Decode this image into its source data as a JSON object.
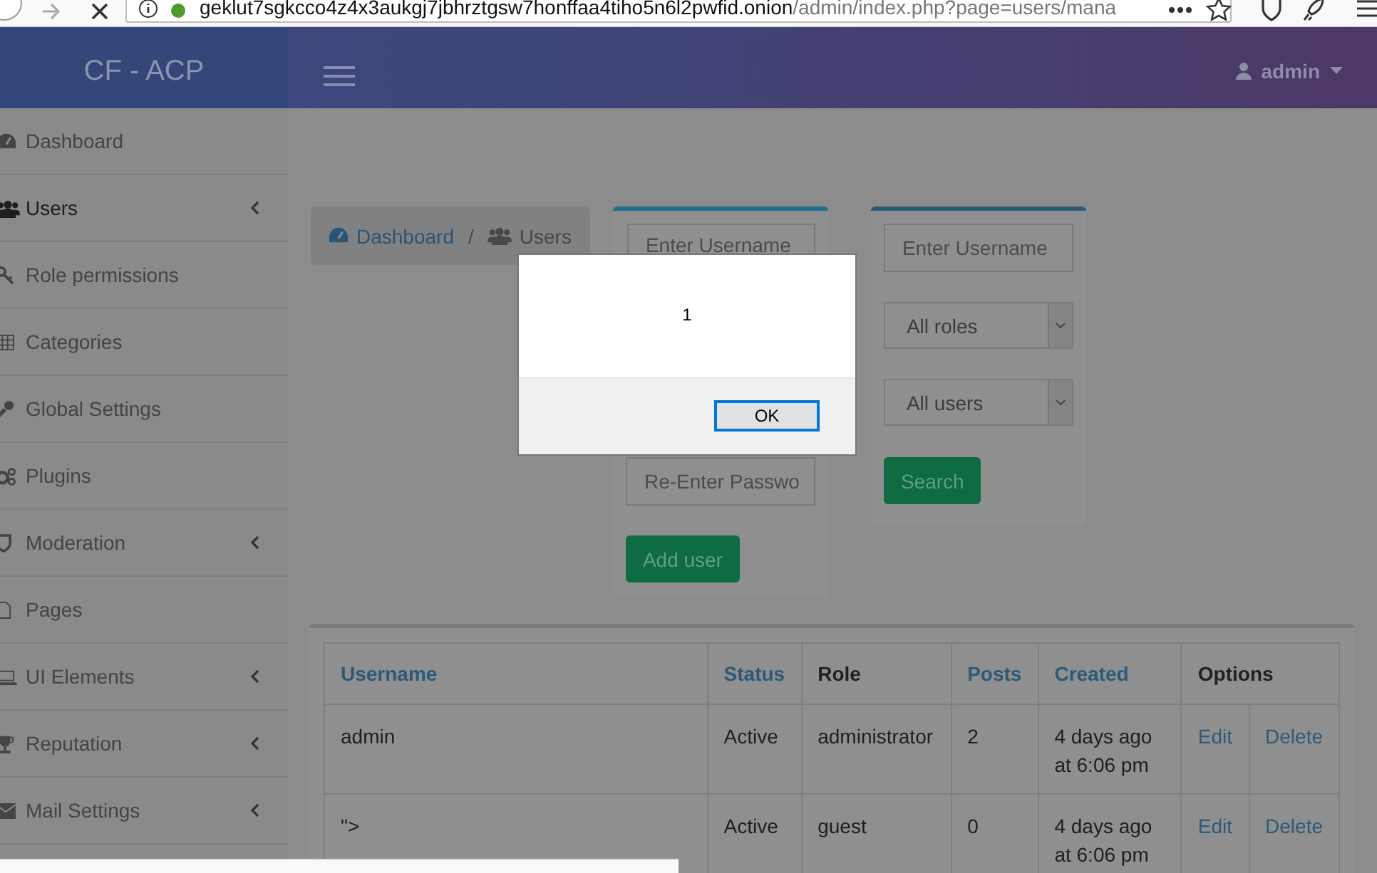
{
  "browser": {
    "url_host": "geklut7sgkcco4z4x3aukgj7jbhrztgsw7honffaa4tiho5n6l2pwfid.onion",
    "url_path": "/admin/index.php?page=users/mana"
  },
  "header": {
    "brand": "CF - ACP",
    "user": "admin"
  },
  "sidebar": {
    "items": [
      {
        "label": "Dashboard",
        "expandable": false,
        "selected": false
      },
      {
        "label": "Users",
        "expandable": true,
        "selected": true
      },
      {
        "label": "Role permissions",
        "expandable": false,
        "selected": false
      },
      {
        "label": "Categories",
        "expandable": false,
        "selected": false
      },
      {
        "label": "Global Settings",
        "expandable": false,
        "selected": false
      },
      {
        "label": "Plugins",
        "expandable": false,
        "selected": false
      },
      {
        "label": "Moderation",
        "expandable": true,
        "selected": false
      },
      {
        "label": "Pages",
        "expandable": false,
        "selected": false
      },
      {
        "label": "UI Elements",
        "expandable": true,
        "selected": false
      },
      {
        "label": "Reputation",
        "expandable": true,
        "selected": false
      },
      {
        "label": "Mail Settings",
        "expandable": true,
        "selected": false
      }
    ]
  },
  "breadcrumb": {
    "items": [
      {
        "label": "Dashboard"
      },
      {
        "label": "Users"
      }
    ],
    "separator": "/"
  },
  "add_user_form": {
    "fields": [
      {
        "placeholder": "Enter Username"
      },
      {
        "placeholder": "Re-Enter Passwo"
      }
    ],
    "button": "Add user"
  },
  "search_form": {
    "field": {
      "placeholder": "Enter Username"
    },
    "selects": [
      {
        "value": "All roles"
      },
      {
        "value": "All users"
      }
    ],
    "button": "Search"
  },
  "table": {
    "columns": [
      {
        "label": "Username",
        "sortable": true
      },
      {
        "label": "Status",
        "sortable": true
      },
      {
        "label": "Role",
        "sortable": false
      },
      {
        "label": "Posts",
        "sortable": true
      },
      {
        "label": "Created",
        "sortable": true
      },
      {
        "label": "Options",
        "sortable": false
      }
    ],
    "rows": [
      {
        "cells": [
          "admin",
          "Active",
          "administrator",
          "2",
          "4 days ago at 6:06 pm"
        ],
        "actions": [
          "Edit",
          "Delete"
        ]
      },
      {
        "cells": [
          "\">",
          "Active",
          "guest",
          "0",
          "4 days ago at 6:06 pm"
        ],
        "actions": [
          "Edit",
          "Delete"
        ]
      }
    ]
  },
  "dialog": {
    "message": "1",
    "button": "OK"
  }
}
